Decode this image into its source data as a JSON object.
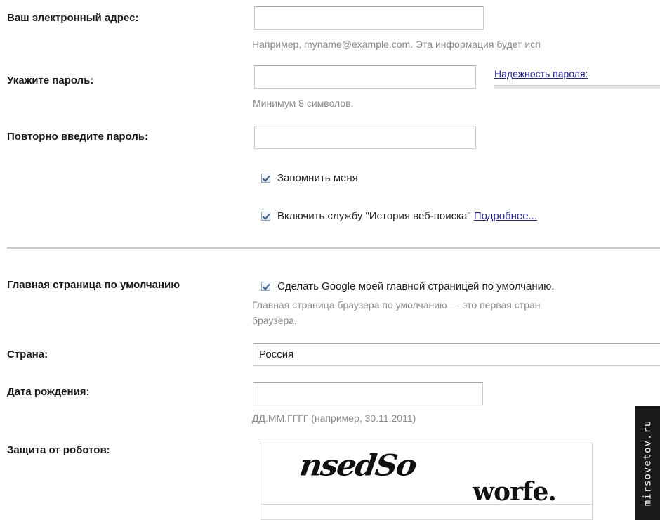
{
  "email": {
    "label": "Ваш электронный адрес:",
    "value": "",
    "hint": "Например, myname@example.com. Эта информация будет исп"
  },
  "password": {
    "label": "Укажите пароль:",
    "value": "",
    "strength_link": "Надежность пароля:",
    "hint": "Минимум 8 символов."
  },
  "confirm_password": {
    "label": "Повторно введите пароль:",
    "value": ""
  },
  "remember_me": {
    "label": "Запомнить меня",
    "checked": true
  },
  "web_history": {
    "label": "Включить службу \"История веб-поиска\"",
    "more_link": "Подробнее...",
    "checked": true
  },
  "homepage": {
    "label": "Главная страница по умолчанию",
    "checkbox_label": "Сделать Google моей главной страницей по умолчанию.",
    "checked": true,
    "hint_line1": "Главная страница браузера по умолчанию — это первая стран",
    "hint_line2": "браузера."
  },
  "country": {
    "label": "Страна:",
    "value": "Россия"
  },
  "birth_date": {
    "label": "Дата рождения:",
    "value": "",
    "hint": "ДД.ММ.ГГГГ (например, 30.11.2011)"
  },
  "captcha": {
    "label": "Защита от роботов:",
    "word1": "nsedSo",
    "word2": "worfe."
  },
  "watermark": "mirsovetov.ru"
}
